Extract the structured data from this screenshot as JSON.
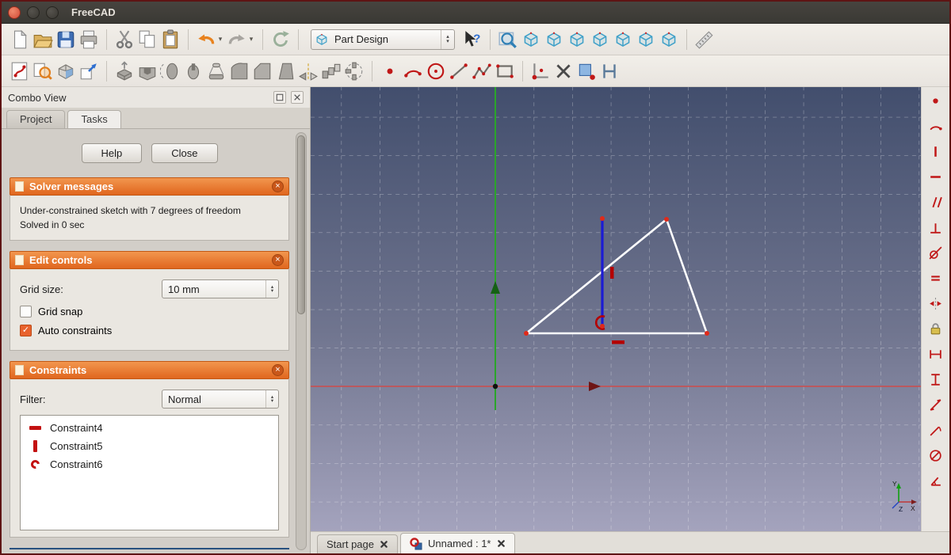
{
  "titlebar": {
    "title": "FreeCAD"
  },
  "toolbars": {
    "workbench": "Part Design",
    "row1": [
      {
        "name": "new-document",
        "icon": "newdoc"
      },
      {
        "name": "open-document",
        "icon": "opendoc"
      },
      {
        "name": "save-document",
        "icon": "save"
      },
      {
        "name": "print-document",
        "icon": "print"
      },
      {
        "sep": true
      },
      {
        "name": "cut",
        "icon": "cut"
      },
      {
        "name": "copy",
        "icon": "copy"
      },
      {
        "name": "paste",
        "icon": "paste"
      },
      {
        "sep": true
      },
      {
        "name": "undo",
        "icon": "undo",
        "dropdown": true
      },
      {
        "name": "redo",
        "icon": "redo",
        "dropdown": true
      },
      {
        "sep": true
      },
      {
        "name": "refresh",
        "icon": "refresh"
      },
      {
        "sep": true
      },
      {
        "widget": "workbench"
      },
      {
        "name": "whats-this",
        "icon": "whatsthis"
      },
      {
        "sep": true
      },
      {
        "name": "fit-all",
        "icon": "fitall"
      },
      {
        "name": "view-axonometric",
        "icon": "cube"
      },
      {
        "name": "view-front",
        "icon": "cube"
      },
      {
        "name": "view-top",
        "icon": "cube"
      },
      {
        "name": "view-right",
        "icon": "cube"
      },
      {
        "name": "view-rear",
        "icon": "cube"
      },
      {
        "name": "view-bottom",
        "icon": "cube"
      },
      {
        "name": "view-left",
        "icon": "cube"
      },
      {
        "sep": true
      },
      {
        "name": "measure-distance",
        "icon": "measure"
      }
    ],
    "row2": [
      {
        "name": "sketch-create",
        "icon": "skcreate"
      },
      {
        "name": "sketch-edit",
        "icon": "skedit"
      },
      {
        "name": "sketch-map",
        "icon": "skmap"
      },
      {
        "name": "sketch-validate",
        "icon": "skvalidate"
      },
      {
        "sep": true
      },
      {
        "name": "pad",
        "icon": "pd_pad"
      },
      {
        "name": "pocket",
        "icon": "pd_pocket"
      },
      {
        "name": "revolution",
        "icon": "pd_rev"
      },
      {
        "name": "groove",
        "icon": "pd_groove"
      },
      {
        "name": "additive-loft",
        "icon": "pd_loft"
      },
      {
        "name": "fillet",
        "icon": "pd_fillet"
      },
      {
        "name": "chamfer",
        "icon": "pd_chamfer"
      },
      {
        "name": "draft",
        "icon": "pd_draft"
      },
      {
        "name": "mirrored",
        "icon": "pd_mir"
      },
      {
        "name": "linear-pattern",
        "icon": "pd_lin"
      },
      {
        "name": "polar-pattern",
        "icon": "pd_pol"
      },
      {
        "sep": true
      },
      {
        "name": "create-point",
        "icon": "g_point"
      },
      {
        "name": "create-arc",
        "icon": "g_arc"
      },
      {
        "name": "create-circle",
        "icon": "g_circle"
      },
      {
        "name": "create-line",
        "icon": "g_line"
      },
      {
        "name": "create-polyline",
        "icon": "g_poly"
      },
      {
        "name": "create-rectangle",
        "icon": "g_rect"
      },
      {
        "sep": true
      },
      {
        "name": "constrain-coincident",
        "icon": "c_coin"
      },
      {
        "name": "trim-edge",
        "icon": "c_trim"
      },
      {
        "name": "external-geometry",
        "icon": "c_ext"
      },
      {
        "name": "toggle-construction",
        "icon": "c_constr"
      }
    ],
    "right": [
      {
        "name": "constraint-coincident",
        "icon": "r_dot"
      },
      {
        "name": "constraint-point-on-object",
        "icon": "r_arc"
      },
      {
        "name": "constraint-vertical",
        "icon": "r_v"
      },
      {
        "name": "constraint-horizontal",
        "icon": "r_h"
      },
      {
        "name": "constraint-parallel",
        "icon": "r_par"
      },
      {
        "name": "constraint-perpendicular",
        "icon": "r_perp"
      },
      {
        "name": "constraint-tangent",
        "icon": "r_tan"
      },
      {
        "name": "constraint-equal",
        "icon": "r_eq"
      },
      {
        "name": "constraint-symmetric",
        "icon": "r_sym"
      },
      {
        "name": "constraint-lock",
        "icon": "r_lock"
      },
      {
        "name": "constraint-distance-x",
        "icon": "r_hd"
      },
      {
        "name": "constraint-distance-y",
        "icon": "r_vd"
      },
      {
        "name": "constraint-distance",
        "icon": "r_len"
      },
      {
        "name": "constraint-radius",
        "icon": "r_rad"
      },
      {
        "name": "constraint-diameter",
        "icon": "r_dia"
      },
      {
        "name": "constraint-angle",
        "icon": "r_ang"
      }
    ]
  },
  "combo_view": {
    "title": "Combo View",
    "tabs": [
      {
        "label": "Project"
      },
      {
        "label": "Tasks"
      }
    ],
    "help_button": "Help",
    "close_button": "Close",
    "sections": {
      "solver": {
        "title": "Solver messages",
        "line1": "Under-constrained sketch with 7 degrees of freedom",
        "line2": "Solved in 0 sec"
      },
      "edit": {
        "title": "Edit controls",
        "grid_size_label": "Grid size:",
        "grid_size_value": "10 mm",
        "grid_snap_label": "Grid snap",
        "grid_snap_checked": false,
        "auto_constraints_label": "Auto constraints",
        "auto_constraints_checked": true
      },
      "constraints": {
        "title": "Constraints",
        "filter_label": "Filter:",
        "filter_value": "Normal",
        "items": [
          {
            "name": "Constraint4",
            "icon": "horizontal"
          },
          {
            "name": "Constraint5",
            "icon": "vertical"
          },
          {
            "name": "Constraint6",
            "icon": "arc"
          }
        ]
      }
    }
  },
  "viewport": {
    "axis_labels": {
      "x": "X",
      "y": "Y",
      "z": "Z"
    }
  },
  "document_tabs": [
    {
      "label": "Start page"
    },
    {
      "label": "Unnamed : 1*"
    }
  ]
}
